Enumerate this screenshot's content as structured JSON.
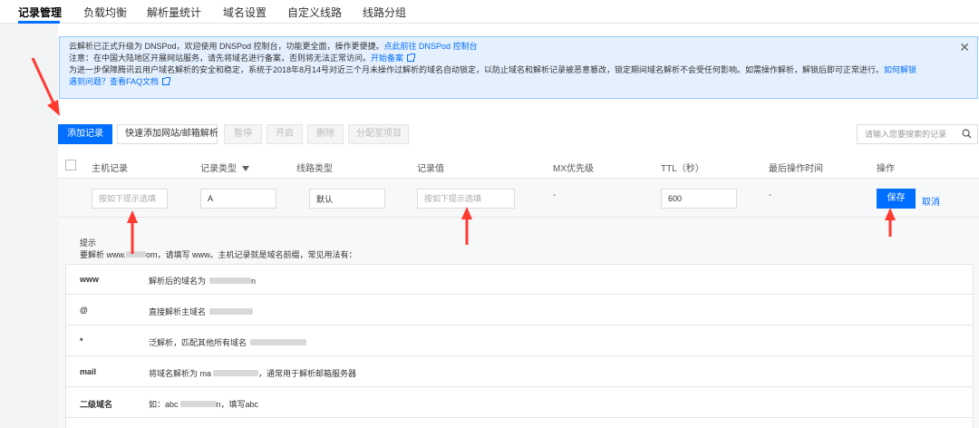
{
  "tabs": [
    {
      "label": "记录管理",
      "active": true
    },
    {
      "label": "负载均衡"
    },
    {
      "label": "解析量统计"
    },
    {
      "label": "域名设置"
    },
    {
      "label": "自定义线路"
    },
    {
      "label": "线路分组"
    }
  ],
  "notice": {
    "line1_text": "云解析已正式升级为 DNSPod，欢迎使用 DNSPod 控制台，功能更全面，操作更便捷。",
    "line1_link": "点此前往 DNSPod 控制台",
    "line2_text": "注意：在中国大陆地区开展网站服务，请先将域名进行备案，否则将无法正常访问。",
    "line2_link": "开始备案",
    "line3_text": "为进一步保障腾讯云用户域名解析的安全和稳定，系统于2018年8月14号对近三个月未操作过解析的域名自动锁定，以防止域名和解析记录被恶意篡改，锁定期间域名解析不会受任何影响。如需操作解析，解锁后即可正常进行。",
    "line3_link": "如何解锁",
    "line4_text": "遇到问题？查看FAQ文档"
  },
  "toolbar": {
    "add_record": "添加记录",
    "quick_add": "快速添加网站/邮箱解析",
    "pause": "暂停",
    "enable": "开启",
    "delete": "删除",
    "assign_project": "分配至项目",
    "search_placeholder": "请输入您要搜索的记录"
  },
  "table_headers": {
    "host": "主机记录",
    "type": "记录类型",
    "line": "线路类型",
    "value": "记录值",
    "mx": "MX优先级",
    "ttl": "TTL（秒）",
    "last_op": "最后操作时间",
    "actions": "操作"
  },
  "edit_row": {
    "host_placeholder": "按如下提示选填",
    "type_value": "A",
    "line_value": "默认",
    "value_placeholder": "按如下提示选填",
    "mx_value": "-",
    "ttl_value": "600",
    "last_op_value": "-",
    "save": "保存",
    "cancel": "取消"
  },
  "hint": {
    "title": "提示",
    "desc_prefix": "要解析 www.",
    "desc_suffix": "om，请填写 www。主机记录就是域名前缀，常见用法有：",
    "rows": [
      {
        "key": "www",
        "prefix": "解析后的域名为",
        "suffix": "n"
      },
      {
        "key": "@",
        "prefix": "直接解析主域名",
        "suffix": ""
      },
      {
        "key": "*",
        "prefix": "泛解析，匹配其他所有域名",
        "suffix": ""
      },
      {
        "key": "mail",
        "prefix": "将域名解析为 ma",
        "suffix": "，通常用于解析邮箱服务器"
      },
      {
        "key": "二级域名",
        "prefix": "如：abc",
        "suffix": "n，填写abc"
      }
    ]
  },
  "colors": {
    "accent": "#006eff",
    "annotation_arrow": "#ff3b30"
  }
}
